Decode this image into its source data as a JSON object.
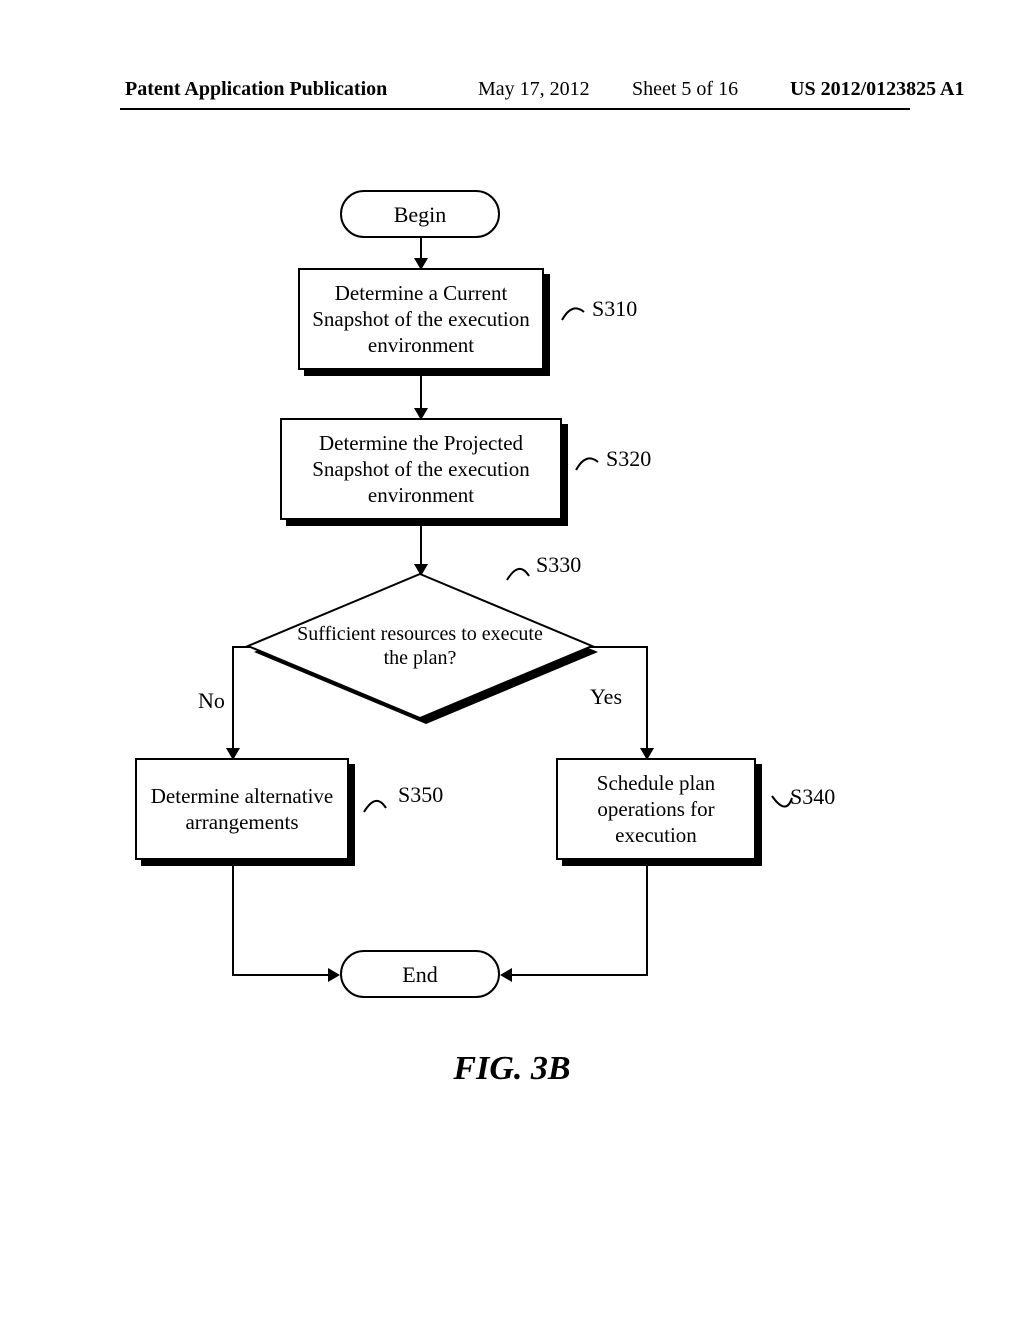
{
  "header": {
    "left": "Patent Application Publication",
    "date": "May 17, 2012",
    "sheet": "Sheet 5 of 16",
    "pub_no": "US 2012/0123825 A1"
  },
  "figure_caption": "FIG. 3B",
  "flow": {
    "begin": "Begin",
    "end": "End",
    "s310": {
      "text": "Determine a Current Snapshot of the execution environment",
      "ref": "S310"
    },
    "s320": {
      "text": "Determine the Projected Snapshot of the execution environment",
      "ref": "S320"
    },
    "s330": {
      "text": "Sufficient resources to execute the plan?",
      "ref": "S330"
    },
    "s340": {
      "text": "Schedule plan operations for execution",
      "ref": "S340"
    },
    "s350": {
      "text": "Determine alternative arrangements",
      "ref": "S350"
    },
    "yes": "Yes",
    "no": "No"
  }
}
